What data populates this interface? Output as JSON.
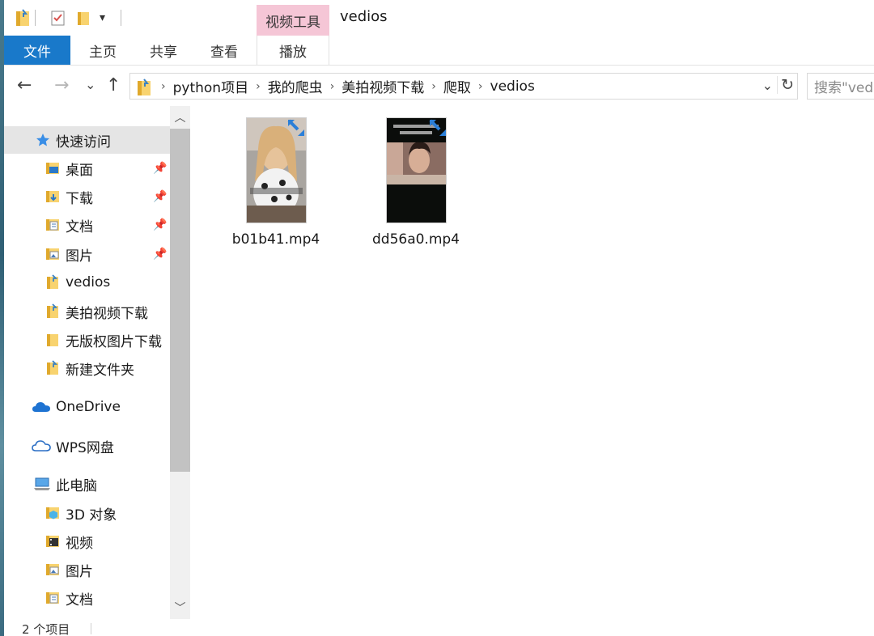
{
  "window": {
    "title": "vedios",
    "context_tab": "视频工具"
  },
  "quick_access_toolbar": {
    "dropdown_glyph": "▾"
  },
  "ribbon": {
    "tabs": [
      {
        "label": "文件"
      },
      {
        "label": "主页"
      },
      {
        "label": "共享"
      },
      {
        "label": "查看"
      },
      {
        "label": "播放"
      }
    ]
  },
  "nav": {
    "back": "←",
    "forward": "→",
    "recent": "⌄",
    "up": "↑",
    "breadcrumb": [
      "python项目",
      "我的爬虫",
      "美拍视频下载",
      "爬取",
      "vedios"
    ],
    "dropdown": "⌄",
    "refresh": "↻",
    "search_placeholder": "搜索\"vedios\""
  },
  "navpane": {
    "quick_access": "快速访问",
    "pinned": [
      {
        "label": "桌面",
        "icon": "desktop-folder-icon"
      },
      {
        "label": "下载",
        "icon": "download-folder-icon"
      },
      {
        "label": "文档",
        "icon": "documents-folder-icon"
      },
      {
        "label": "图片",
        "icon": "pictures-folder-icon"
      }
    ],
    "recent": [
      {
        "label": "vedios"
      },
      {
        "label": "美拍视频下载"
      },
      {
        "label": "无版权图片下载"
      },
      {
        "label": "新建文件夹"
      }
    ],
    "onedrive": "OneDrive",
    "wps": "WPS网盘",
    "this_pc": "此电脑",
    "pc_items": [
      {
        "label": "3D 对象"
      },
      {
        "label": "视频"
      },
      {
        "label": "图片"
      },
      {
        "label": "文档"
      }
    ]
  },
  "files": [
    {
      "name": "b01b41.mp4"
    },
    {
      "name": "dd56a0.mp4"
    }
  ],
  "status": {
    "count": "2 个项目"
  },
  "colors": {
    "accent": "#1979ca",
    "context_tab": "#f5c6d6",
    "selection": "#e5e5e5",
    "folder": "#f8d36f"
  }
}
